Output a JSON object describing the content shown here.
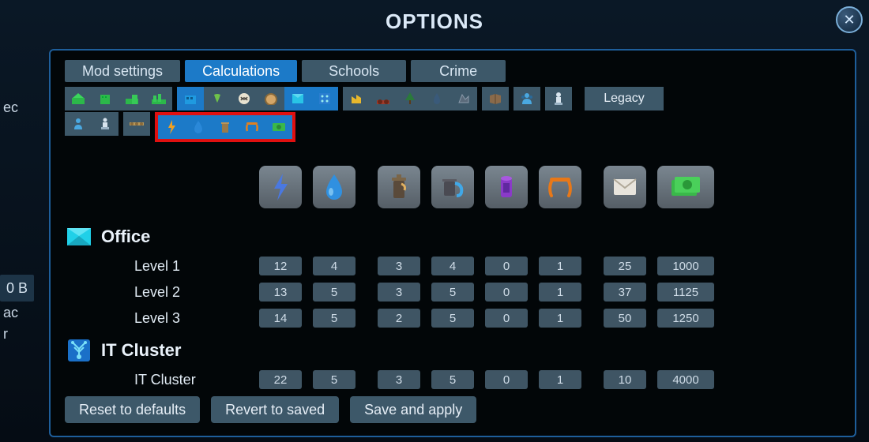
{
  "title": "OPTIONS",
  "tabs": [
    {
      "label": "Mod settings",
      "active": false
    },
    {
      "label": "Calculations",
      "active": true
    },
    {
      "label": "Schools",
      "active": false
    },
    {
      "label": "Crime",
      "active": false
    }
  ],
  "legacy_label": "Legacy",
  "columns": [
    "power",
    "water",
    "sewage",
    "garbage",
    "pollution",
    "noise",
    "mail",
    "income"
  ],
  "zone_office": {
    "label": "Office"
  },
  "zone_it": {
    "label": "IT Cluster"
  },
  "rows": {
    "level1": {
      "label": "Level 1",
      "vals": [
        "12",
        "4",
        "3",
        "4",
        "0",
        "1",
        "25",
        "1000"
      ]
    },
    "level2": {
      "label": "Level 2",
      "vals": [
        "13",
        "5",
        "3",
        "5",
        "0",
        "1",
        "37",
        "1125"
      ]
    },
    "level3": {
      "label": "Level 3",
      "vals": [
        "14",
        "5",
        "2",
        "5",
        "0",
        "1",
        "50",
        "1250"
      ]
    },
    "it": {
      "label": "IT Cluster",
      "vals": [
        "22",
        "5",
        "3",
        "5",
        "0",
        "1",
        "10",
        "4000"
      ]
    }
  },
  "footer": {
    "reset": "Reset to defaults",
    "revert": "Revert to saved",
    "save": "Save and apply"
  },
  "left_fragments": [
    "ec",
    "0 B",
    "[B",
    "ac",
    "r"
  ],
  "zero_badge": "0 B"
}
